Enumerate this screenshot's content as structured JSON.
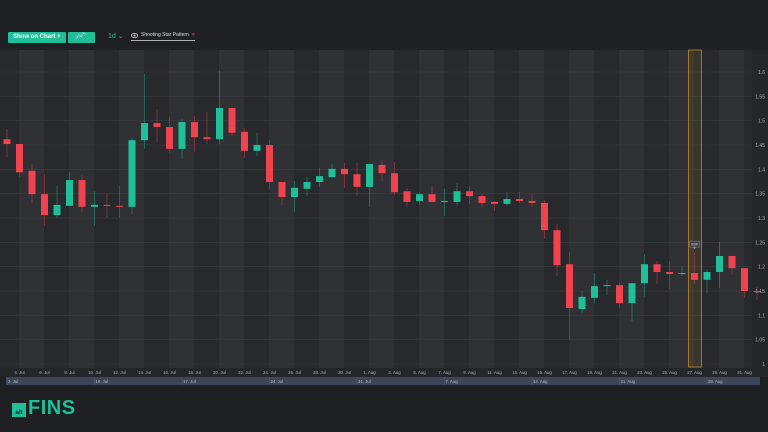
{
  "toolbar": {
    "show_on_chart_label": "Show on Chart +",
    "indicators_icon": "indicators-icon",
    "interval": "1d",
    "interval_chevron": "⌄",
    "pattern_tag": {
      "icon": "eye-icon",
      "label": "Shooting Star Pattern",
      "close": "×"
    }
  },
  "colors": {
    "up": "#1fbf9a",
    "down": "#f0434f",
    "accent": "#1fbf9a",
    "highlight": "#c08a2a"
  },
  "chart_data": {
    "type": "candlestick",
    "y_ticks": [
      "1.6",
      "1.55",
      "1.5",
      "1.45",
      "1.4",
      "1.35",
      "1.3",
      "1.25",
      "1.2",
      "1.15",
      "1.1",
      "1.05",
      "1"
    ],
    "ylim": [
      1,
      1.6
    ],
    "x_ticks": [
      "4. Jul",
      "6. Jul",
      "8. Jul",
      "10. Jul",
      "12. Jul",
      "14. Jul",
      "16. Jul",
      "18. Jul",
      "20. Jul",
      "22. Jul",
      "24. Jul",
      "26. Jul",
      "28. Jul",
      "30. Jul",
      "1. Aug",
      "3. Aug",
      "5. Aug",
      "7. Aug",
      "9. Aug",
      "11. Aug",
      "13. Aug",
      "15. Aug",
      "17. Aug",
      "19. Aug",
      "21. Aug",
      "23. Aug",
      "25. Aug",
      "27. Aug",
      "29. Aug",
      "31. Aug"
    ],
    "navigator_labels": [
      "3. Jul",
      "10. Jul",
      "17. Jul",
      "24. Jul",
      "31. Jul",
      "7. Aug",
      "14. Aug",
      "21. Aug",
      "28. Aug"
    ],
    "first_date": "3. Jul",
    "ohlc": [
      [
        1.462,
        1.483,
        1.425,
        1.452
      ],
      [
        1.452,
        1.452,
        1.384,
        1.394
      ],
      [
        1.397,
        1.411,
        1.331,
        1.349
      ],
      [
        1.349,
        1.39,
        1.284,
        1.306
      ],
      [
        1.306,
        1.366,
        1.3,
        1.327
      ],
      [
        1.325,
        1.394,
        1.323,
        1.378
      ],
      [
        1.378,
        1.388,
        1.312,
        1.323
      ],
      [
        1.323,
        1.355,
        1.284,
        1.327
      ],
      [
        1.327,
        1.351,
        1.302,
        1.325
      ],
      [
        1.325,
        1.366,
        1.302,
        1.323
      ],
      [
        1.323,
        1.464,
        1.308,
        1.46
      ],
      [
        1.46,
        1.596,
        1.442,
        1.495
      ],
      [
        1.495,
        1.524,
        1.456,
        1.487
      ],
      [
        1.487,
        1.508,
        1.434,
        1.442
      ],
      [
        1.442,
        1.503,
        1.421,
        1.497
      ],
      [
        1.497,
        1.51,
        1.436,
        1.466
      ],
      [
        1.466,
        1.518,
        1.452,
        1.462
      ],
      [
        1.462,
        1.602,
        1.452,
        1.526
      ],
      [
        1.526,
        1.526,
        1.468,
        1.475
      ],
      [
        1.477,
        1.485,
        1.423,
        1.438
      ],
      [
        1.438,
        1.475,
        1.427,
        1.45
      ],
      [
        1.45,
        1.46,
        1.358,
        1.374
      ],
      [
        1.374,
        1.374,
        1.327,
        1.343
      ],
      [
        1.343,
        1.376,
        1.312,
        1.362
      ],
      [
        1.36,
        1.384,
        1.345,
        1.374
      ],
      [
        1.374,
        1.403,
        1.364,
        1.386
      ],
      [
        1.384,
        1.411,
        1.382,
        1.401
      ],
      [
        1.401,
        1.413,
        1.362,
        1.39
      ],
      [
        1.39,
        1.413,
        1.345,
        1.364
      ],
      [
        1.364,
        1.411,
        1.323,
        1.411
      ],
      [
        1.409,
        1.419,
        1.376,
        1.392
      ],
      [
        1.392,
        1.415,
        1.347,
        1.353
      ],
      [
        1.355,
        1.362,
        1.323,
        1.333
      ],
      [
        1.335,
        1.353,
        1.327,
        1.349
      ],
      [
        1.349,
        1.366,
        1.331,
        1.333
      ],
      [
        1.333,
        1.36,
        1.304,
        1.335
      ],
      [
        1.333,
        1.372,
        1.325,
        1.355
      ],
      [
        1.355,
        1.366,
        1.329,
        1.345
      ],
      [
        1.345,
        1.349,
        1.323,
        1.331
      ],
      [
        1.333,
        1.335,
        1.314,
        1.329
      ],
      [
        1.329,
        1.353,
        1.325,
        1.339
      ],
      [
        1.339,
        1.353,
        1.331,
        1.335
      ],
      [
        1.335,
        1.349,
        1.323,
        1.331
      ],
      [
        1.331,
        1.337,
        1.257,
        1.275
      ],
      [
        1.275,
        1.288,
        1.181,
        1.203
      ],
      [
        1.205,
        1.23,
        1.051,
        1.115
      ],
      [
        1.113,
        1.15,
        1.105,
        1.138
      ],
      [
        1.136,
        1.187,
        1.125,
        1.16
      ],
      [
        1.16,
        1.173,
        1.142,
        1.162
      ],
      [
        1.162,
        1.168,
        1.115,
        1.125
      ],
      [
        1.125,
        1.166,
        1.088,
        1.166
      ],
      [
        1.166,
        1.226,
        1.138,
        1.205
      ],
      [
        1.205,
        1.212,
        1.164,
        1.189
      ],
      [
        1.189,
        1.212,
        1.154,
        1.185
      ],
      [
        1.185,
        1.201,
        1.181,
        1.187
      ],
      [
        1.187,
        1.23,
        1.164,
        1.173
      ],
      [
        1.173,
        1.195,
        1.146,
        1.189
      ],
      [
        1.189,
        1.251,
        1.156,
        1.222
      ],
      [
        1.222,
        1.222,
        1.183,
        1.197
      ],
      [
        1.197,
        1.197,
        1.136,
        1.15
      ],
      [
        1.15,
        1.158,
        1.131,
        1.148
      ]
    ],
    "annotations": [
      {
        "label": "SSP",
        "date": "27. Aug",
        "pattern": "Shooting Star Pattern"
      }
    ]
  },
  "logo": {
    "prefix": "alt",
    "name": "FINS"
  }
}
